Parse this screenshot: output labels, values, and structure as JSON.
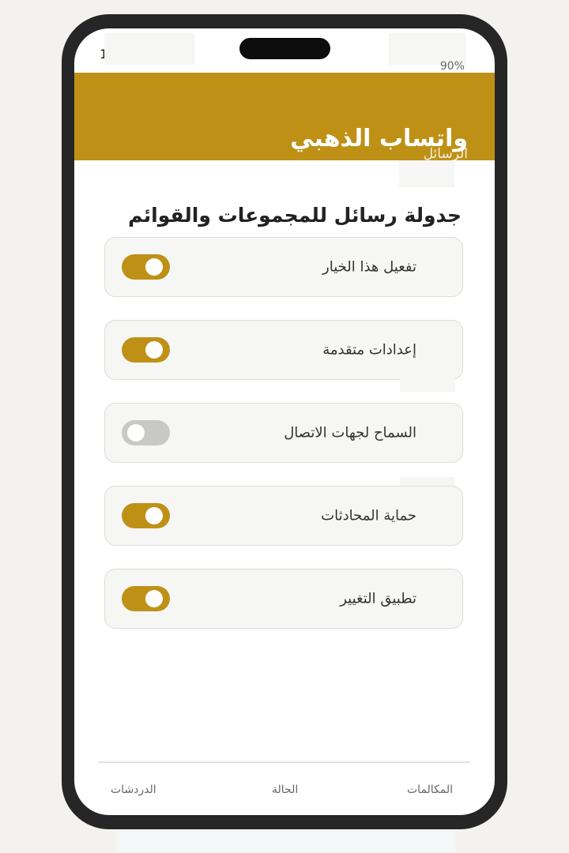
{
  "status_bar": {
    "time": "1",
    "battery": "90%"
  },
  "header": {
    "title": "واتساب الذهبي",
    "subtitle": "الرسائل"
  },
  "section": {
    "title": "جدولة رسائل للمجموعات والقوائم"
  },
  "settings": [
    {
      "label": "تفعيل هذا الخيار",
      "enabled": true
    },
    {
      "label": "إعدادات متقدمة",
      "enabled": true
    },
    {
      "label": "السماح لجهات الاتصال",
      "enabled": false
    },
    {
      "label": "حماية المحادثات",
      "enabled": true
    },
    {
      "label": "تطبيق التغيير",
      "enabled": true
    }
  ],
  "bottom_nav": {
    "calls": "المكالمات",
    "status": "الحالة",
    "chats": "الدردشات"
  },
  "colors": {
    "accent": "#be9116",
    "toggle_off": "#c8c8c6",
    "frame": "#262626"
  }
}
